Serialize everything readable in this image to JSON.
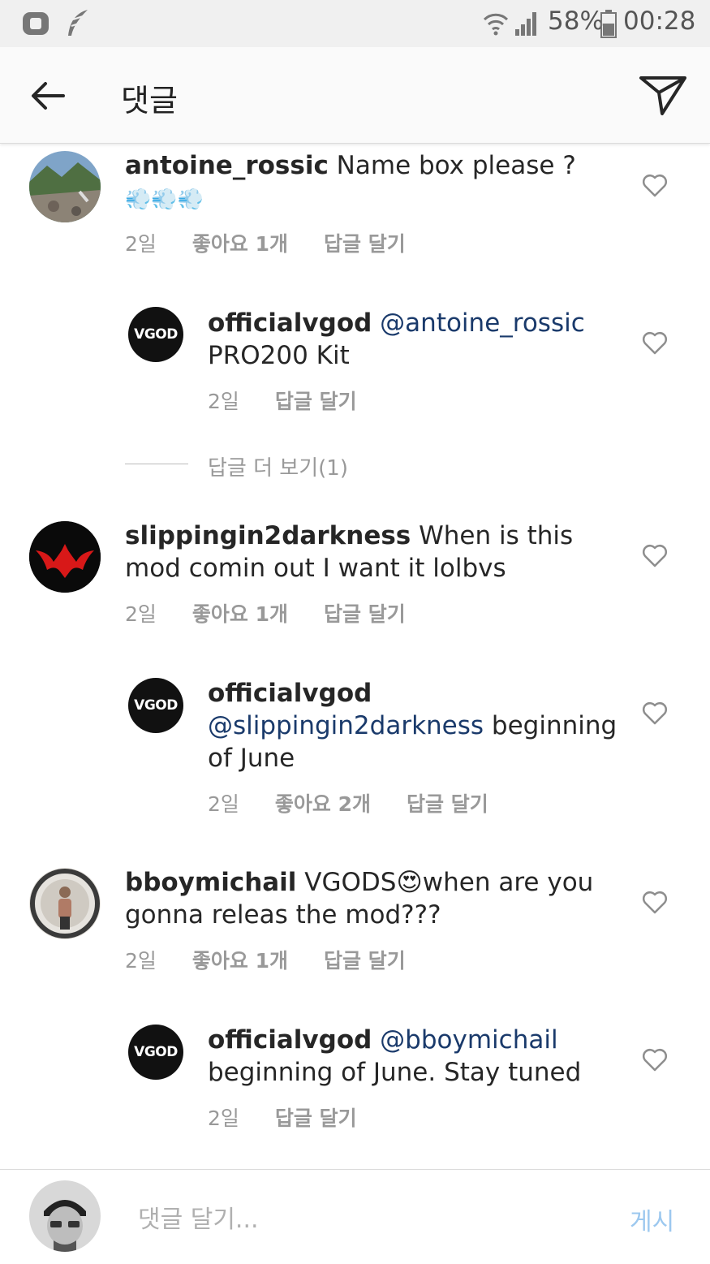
{
  "status_bar": {
    "battery": "58%",
    "time": "00:28"
  },
  "header": {
    "title": "댓글"
  },
  "comments": [
    {
      "username": "antoine_rossic",
      "text": " Name box please ?",
      "emoji": "💨💨💨",
      "time": "2일",
      "likes": "좋아요 1개",
      "reply": "답글 달기"
    },
    {
      "username": "officialvgod",
      "mention": "@antoine_rossic",
      "text": "PRO200 Kit",
      "time": "2일",
      "reply": "답글 달기",
      "avatar_text": "VGOD"
    },
    {
      "username": "slippingin2darkness",
      "text": " When is this mod comin out I want it lolbvs",
      "time": "2일",
      "likes": "좋아요 1개",
      "reply": "답글 달기"
    },
    {
      "username": "officialvgod",
      "mention": "@slippingin2darkness",
      "text": " beginning of June",
      "time": "2일",
      "likes": "좋아요 2개",
      "reply": "답글 달기",
      "avatar_text": "VGOD"
    },
    {
      "username": "bboymichail",
      "text": " VGODS😍when are you gonna releas the mod???",
      "time": "2일",
      "likes": "좋아요 1개",
      "reply": "답글 달기"
    },
    {
      "username": "officialvgod",
      "mention": "@bboymichail",
      "text": "beginning of June. Stay tuned",
      "time": "2일",
      "reply": "답글 달기",
      "avatar_text": "VGOD"
    }
  ],
  "view_more_replies": "답글 더 보기(1)",
  "footer": {
    "placeholder": "댓글 달기...",
    "post_label": "게시"
  }
}
